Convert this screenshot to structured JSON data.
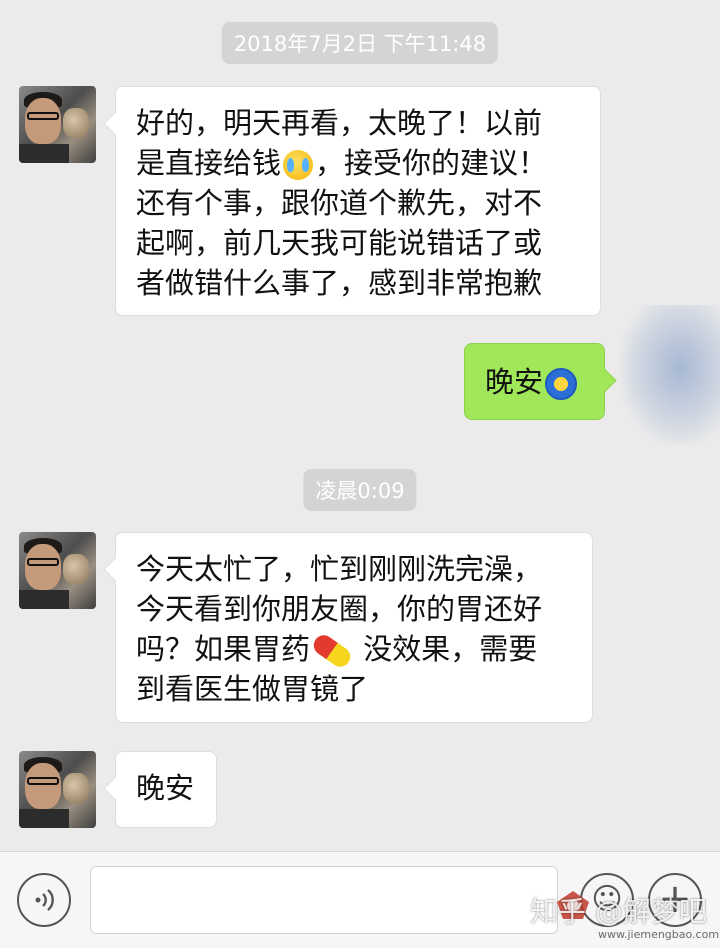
{
  "timestamps": [
    "2018年7月2日 下午11:48",
    "凌晨0:09"
  ],
  "messages": [
    {
      "side": "left",
      "lines": [
        "好的，明天再看，太晚了！以前",
        [
          "是直接给钱",
          "，接受你的建议！"
        ],
        "还有个事，跟你道个歉先，对不",
        "起啊，前几天我可能说错话了或",
        "者做错什么事了，感到非常抱歉"
      ],
      "emoji": "crying-face-emoji"
    },
    {
      "side": "right",
      "text": "晚安",
      "emoji": "moon-face-emoji"
    },
    {
      "side": "left",
      "lines": [
        "今天太忙了，忙到刚刚洗完澡，",
        "今天看到你朋友圈，你的胃还好",
        [
          "吗？如果胃药",
          " 没效果，需要"
        ],
        "到看医生做胃镜了"
      ],
      "emoji": "pill-emoji"
    },
    {
      "side": "left",
      "text": "晚安"
    }
  ],
  "input_bar": {
    "value": "",
    "placeholder": "",
    "icons": [
      "voice-icon",
      "emoji-icon",
      "plus-icon"
    ]
  },
  "watermark": {
    "text": "知乎 @解梦吧",
    "site": "www.jiemengbao.com"
  },
  "colors": {
    "background": "#ebebeb",
    "left_bubble": "#ffffff",
    "right_bubble": "#a0e759",
    "timestamp_bg": "#d4d4d4"
  }
}
